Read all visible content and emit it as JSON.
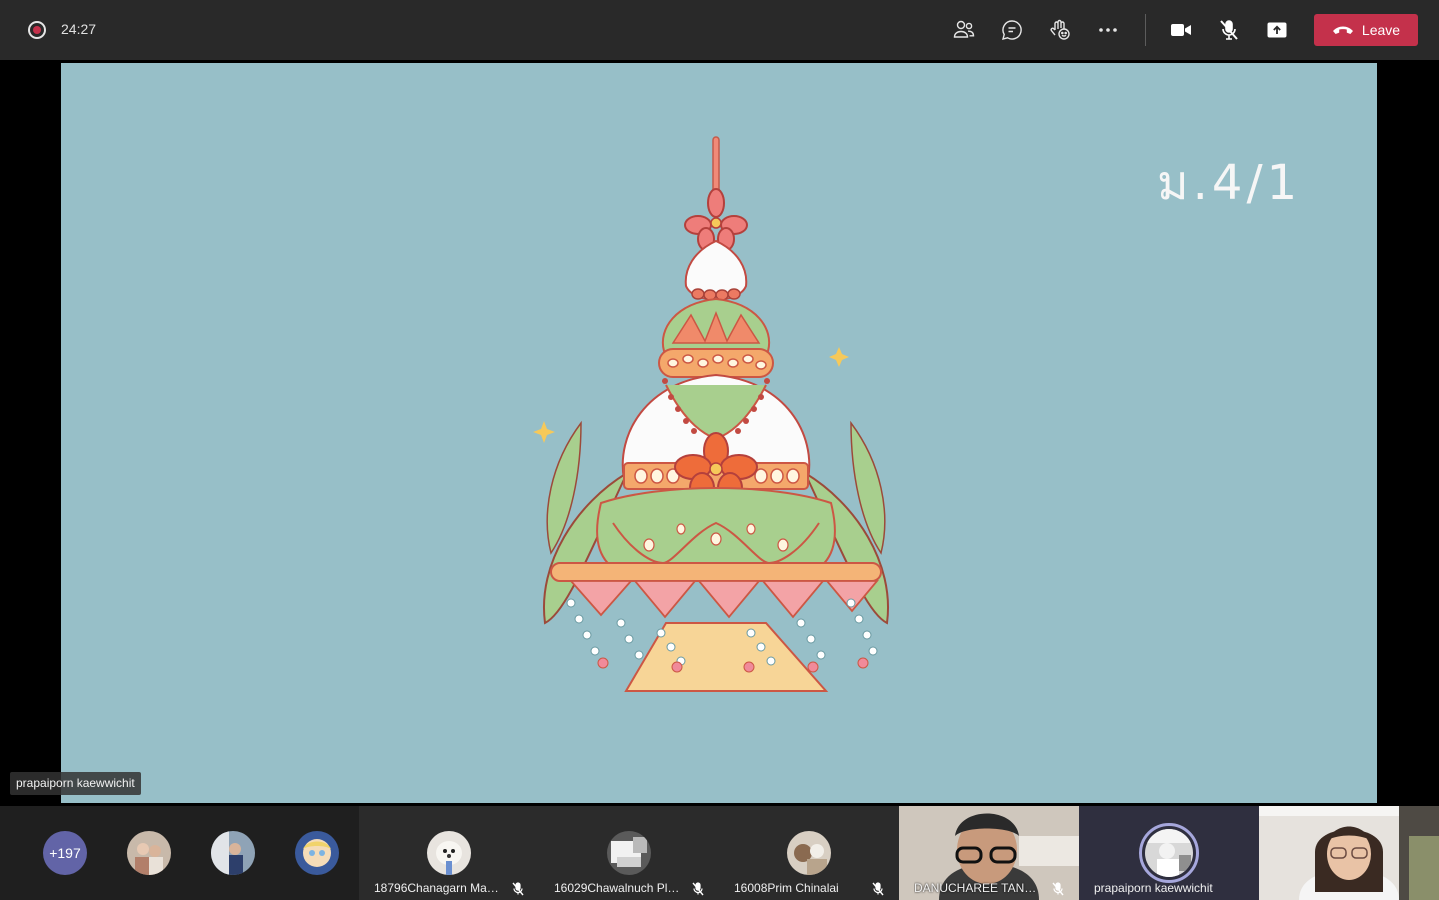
{
  "meeting": {
    "timer": "24:27",
    "leave_label": "Leave",
    "accent_leave": "#c4314b"
  },
  "toolbar": {
    "icons": [
      "people-icon",
      "chat-icon",
      "reactions-icon",
      "more-icon",
      "camera-icon",
      "mic-off-icon",
      "share-icon",
      "phone-hangup-icon"
    ]
  },
  "stage": {
    "slide_label": "ม.4/1",
    "presenter_name": "prapaiporn kaewwichit",
    "slide_background": "#97bfc8"
  },
  "gallery": {
    "overflow_count": "+197",
    "tiles": [
      {
        "name": "18796Chanagarn Mar...",
        "muted": true
      },
      {
        "name": "16029Chawalnuch Plu...",
        "muted": true
      },
      {
        "name": "16008Prim Chinalai",
        "muted": true
      },
      {
        "name": "DANUCHAREE TANTH...",
        "muted": true
      },
      {
        "name": "prapaiporn kaewwichit",
        "muted": false
      },
      {
        "name": "",
        "muted": false
      }
    ]
  }
}
